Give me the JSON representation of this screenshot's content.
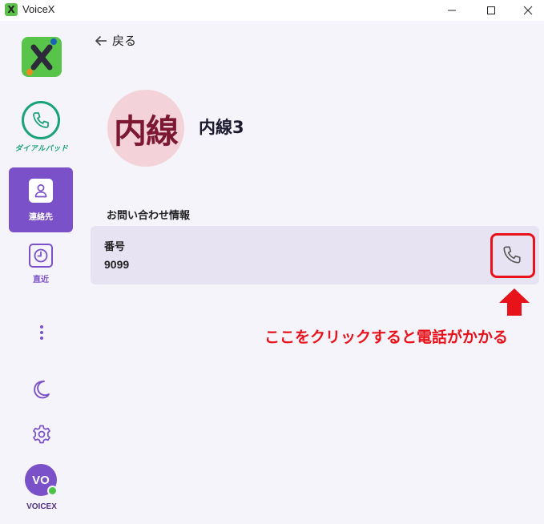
{
  "window": {
    "title": "VoiceX",
    "logo_letter": "X"
  },
  "sidebar": {
    "dialpad_label": "ダイアルパッド",
    "contacts_label": "連絡先",
    "recent_label": "直近",
    "avatar_initials": "VO",
    "avatar_label": "VOICEX",
    "accent_color": "#7a51c9",
    "dialpad_color": "#1aa37a",
    "presence_color": "#4cc246"
  },
  "main": {
    "back_label": "戻る",
    "avatar_text": "内線",
    "contact_name": "内線3",
    "section_title": "お問い合わせ情報",
    "field_label": "番号",
    "field_value": "9099",
    "annotation": "ここをクリックすると電話がかかる",
    "annotation_color": "#e8121b"
  }
}
